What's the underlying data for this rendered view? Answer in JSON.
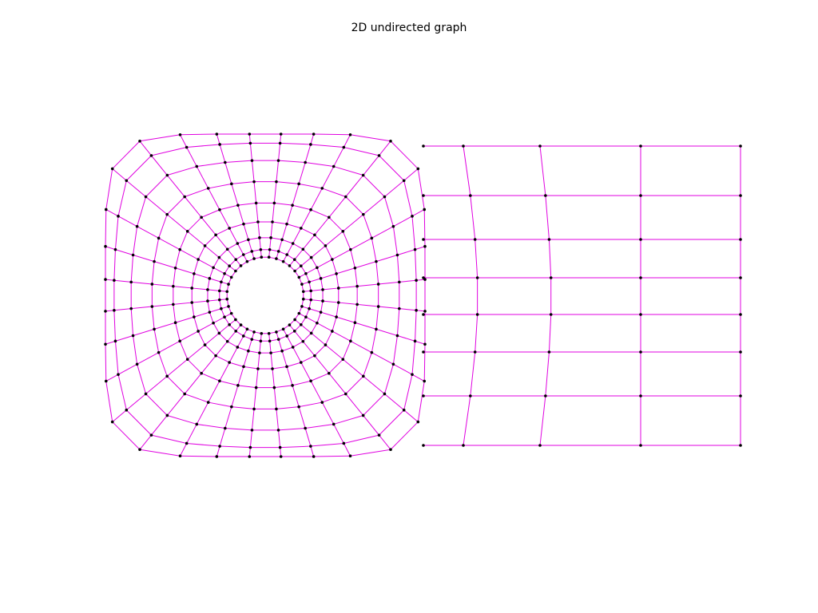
{
  "figure": {
    "title": "2D undirected graph"
  },
  "colors": {
    "edge": "#e000e0",
    "node": "#000000",
    "background": "#ffffff"
  },
  "graph": {
    "type": "2d-undirected-graph",
    "description_visible_only": true
  }
}
